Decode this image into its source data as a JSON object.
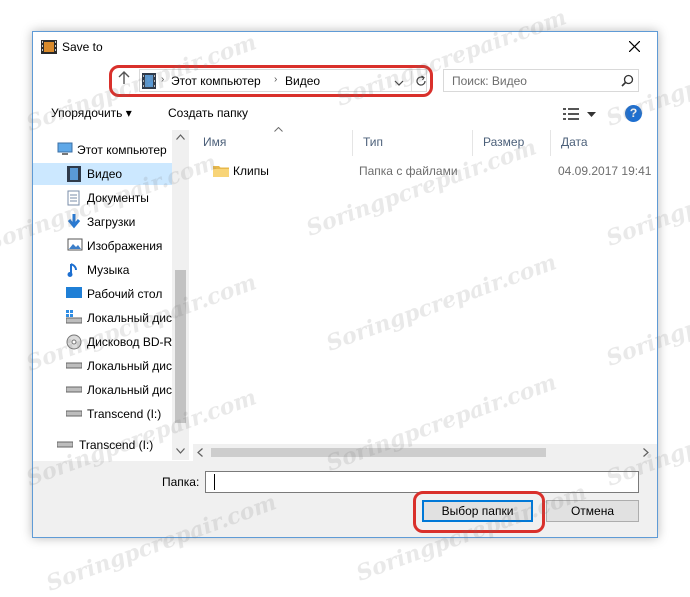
{
  "window": {
    "title": "Save to"
  },
  "address_bar": {
    "breadcrumbs": [
      "Этот компьютер",
      "Видео"
    ]
  },
  "search": {
    "placeholder": "Поиск: Видео"
  },
  "toolbar": {
    "organize_label": "Упорядочить ▾",
    "new_folder_label": "Создать папку",
    "help_label": "?"
  },
  "nav_items": [
    {
      "label": "Этот компьютер",
      "icon": "computer-icon"
    },
    {
      "label": "Видео",
      "icon": "video-folder-icon",
      "selected": true
    },
    {
      "label": "Документы",
      "icon": "documents-icon"
    },
    {
      "label": "Загрузки",
      "icon": "downloads-icon"
    },
    {
      "label": "Изображения",
      "icon": "pictures-icon"
    },
    {
      "label": "Музыка",
      "icon": "music-icon"
    },
    {
      "label": "Рабочий стол",
      "icon": "desktop-icon"
    },
    {
      "label": "Локальный дис",
      "icon": "local-disk-icon"
    },
    {
      "label": "Дисковод BD-RC",
      "icon": "optical-drive-icon"
    },
    {
      "label": "Локальный дис",
      "icon": "drive-icon"
    },
    {
      "label": "Локальный дис",
      "icon": "drive-icon"
    },
    {
      "label": "Transcend (I:)",
      "icon": "drive-icon"
    },
    {
      "label": "Transcend (I:)",
      "icon": "drive-icon"
    }
  ],
  "columns": [
    "Имя",
    "Тип",
    "Размер",
    "Дата"
  ],
  "files": [
    {
      "name": "Клипы",
      "type": "Папка с файлами",
      "size": "",
      "date": "04.09.2017 19:41"
    }
  ],
  "footer": {
    "folder_label": "Папка:",
    "folder_value": "",
    "select_button": "Выбор папки",
    "cancel_button": "Отмена"
  },
  "watermark": "Soringpcrepair.com",
  "colors": {
    "accent": "#0078d7",
    "highlight": "#d9302b",
    "selection": "#cce8ff"
  }
}
